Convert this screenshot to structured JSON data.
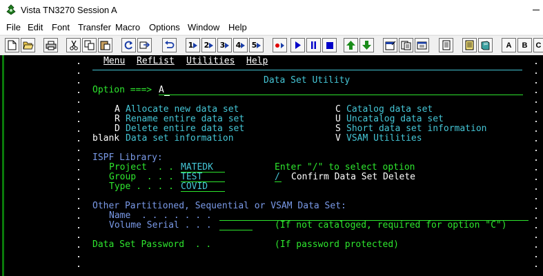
{
  "window": {
    "title": "Vista TN3270 Session A"
  },
  "menubar": [
    "File",
    "Edit",
    "Font",
    "Transfer",
    "Macro",
    "Options",
    "Window",
    "Help"
  ],
  "toolbar": {
    "numbers": [
      "1",
      "2",
      "3",
      "4",
      "5"
    ],
    "letters": [
      "A",
      "B",
      "C"
    ],
    "colors": {
      "record": "#e00000",
      "play": "#0000c8",
      "arrow_green": "#1a8c1a"
    }
  },
  "terminal": {
    "menu": [
      "Menu",
      "RefList",
      "Utilities",
      "Help"
    ],
    "panel_title": "Data Set Utility",
    "option_label": "Option ===>",
    "option_value": "A",
    "options_left": [
      {
        "key": "A",
        "text": "Allocate new data set"
      },
      {
        "key": "R",
        "text": "Rename entire data set"
      },
      {
        "key": "D",
        "text": "Delete entire data set"
      },
      {
        "key": "blank",
        "text": "Data set information"
      }
    ],
    "options_right": [
      {
        "key": "C",
        "text": "Catalog data set"
      },
      {
        "key": "U",
        "text": "Uncatalog data set"
      },
      {
        "key": "S",
        "text": "Short data set information"
      },
      {
        "key": "V",
        "text": "VSAM Utilities"
      }
    ],
    "library_header": "ISPF Library:",
    "project_label": "Project  . .",
    "project_value": "MATEDK",
    "group_label": "Group  . . .",
    "group_value": "TEST",
    "type_label": "Type . . . .",
    "type_value": "COVID",
    "select_hint": "Enter \"/\" to select option",
    "confirm_value": "/",
    "confirm_label": "Confirm Data Set Delete",
    "other_header": "Other Partitioned, Sequential or VSAM Data Set:",
    "name_label": "Name  . . . . . . .",
    "volume_label": "Volume Serial . . .",
    "volume_hint": "(If not cataloged, required for option \"C\")",
    "password_label": "Data Set Password  . .",
    "password_hint": "(If password protected)"
  }
}
